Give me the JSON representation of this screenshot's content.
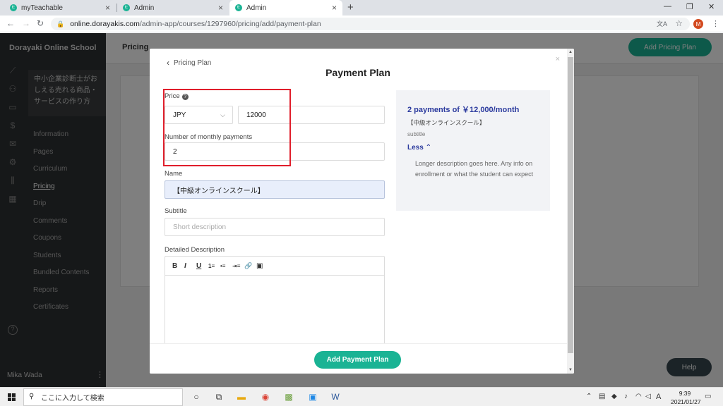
{
  "browser": {
    "tabs": [
      {
        "label": "myTeachable",
        "favicon": "t:"
      },
      {
        "label": "Admin",
        "favicon": "t:"
      },
      {
        "label": "Admin",
        "favicon": "t:"
      }
    ],
    "new_tab": "+",
    "url_host": "online.dorayakis.com",
    "url_path": "/admin-app/courses/1297960/pricing/add/payment-plan",
    "profile_initial": "M",
    "window_controls": [
      "—",
      "❐",
      "✕"
    ]
  },
  "app": {
    "school_name": "Dorayaki Online School",
    "course_title": "中小企業診断士がおしえる売れる商品・サービスの作り方",
    "menu": [
      "Information",
      "Pages",
      "Curriculum",
      "Pricing",
      "Drip",
      "Comments",
      "Coupons",
      "Students",
      "Bundled Contents",
      "Reports",
      "Certificates"
    ],
    "active_menu": "Pricing",
    "page_title": "Pricing",
    "add_pricing_button": "Add Pricing Plan",
    "user_name": "Mika Wada",
    "help_button": "Help"
  },
  "modal": {
    "back_link": "Pricing Plan",
    "title": "Payment Plan",
    "close": "×",
    "price_label": "Price",
    "currency": "JPY",
    "price_value": "12000",
    "payments_label": "Number of monthly payments",
    "payments_value": "2",
    "name_label": "Name",
    "name_value": "【中級オンラインスクール】",
    "subtitle_label": "Subtitle",
    "subtitle_placeholder": "Short description",
    "description_label": "Detailed Description",
    "toolbar": [
      "B",
      "I",
      "U",
      "1≡",
      "•≡",
      "⇥≡",
      "🔗",
      "▣"
    ],
    "submit_button": "Add Payment Plan",
    "preview": {
      "title": "2 payments of ￥12,000/month",
      "name": "【中級オンラインスクール】",
      "subtitle": "subtitle",
      "less": "Less",
      "description": "Longer description goes here. Any info on enrollment or what the student can expect"
    }
  },
  "taskbar": {
    "search_placeholder": "ここに入力して検索",
    "ime": "A",
    "time": "9:39",
    "date": "2021/01/27"
  },
  "colors": {
    "accent": "#1ab394",
    "preview_title": "#2b3a9e",
    "highlight_box": "#e01e2b"
  }
}
